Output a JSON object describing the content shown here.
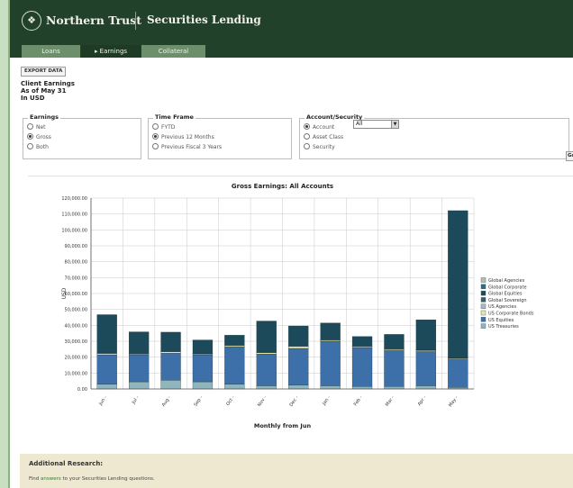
{
  "header": {
    "brand": "Northern Trust",
    "app_title": "Securities Lending"
  },
  "tabs": [
    {
      "label": "Loans",
      "active": false
    },
    {
      "label": "▸ Earnings",
      "active": true
    },
    {
      "label": "Collateral",
      "active": false
    }
  ],
  "export_label": "EXPORT DATA",
  "info": {
    "line1": "Client Earnings",
    "line2": "As of May 31",
    "line3": "In USD"
  },
  "earnings_box": {
    "legend": "Earnings",
    "options": [
      {
        "label": "Net",
        "selected": false
      },
      {
        "label": "Gross",
        "selected": true
      },
      {
        "label": "Both",
        "selected": false
      }
    ]
  },
  "timeframe_box": {
    "legend": "Time Frame",
    "options": [
      {
        "label": "FYTD",
        "selected": false
      },
      {
        "label": "Previous 12 Months",
        "selected": true
      },
      {
        "label": "Previous Fiscal 3 Years",
        "selected": false
      }
    ]
  },
  "account_box": {
    "legend": "Account/Security",
    "options": [
      {
        "label": "Account",
        "selected": true
      },
      {
        "label": "Asset Class",
        "selected": false
      },
      {
        "label": "Security",
        "selected": false
      }
    ],
    "select_value": "All"
  },
  "go_label": "Go",
  "chart_data": {
    "type": "bar",
    "stacked": true,
    "title": "Gross Earnings: All Accounts",
    "xlabel": "Monthly from Jun",
    "ylabel": "USD",
    "ylim": [
      0,
      120000
    ],
    "yticks": [
      0,
      10000,
      20000,
      30000,
      40000,
      50000,
      60000,
      70000,
      80000,
      90000,
      100000,
      110000,
      120000
    ],
    "ytick_labels": [
      "0.00",
      "10,000.00",
      "20,000.00",
      "30,000.00",
      "40,000.00",
      "50,000.00",
      "60,000.00",
      "70,000.00",
      "80,000.00",
      "90,000.00",
      "100,000.00",
      "110,000.00",
      "120,000.00"
    ],
    "categories": [
      "Jun -",
      "Jul -",
      "Aug -",
      "Sep -",
      "Oct -",
      "Nov -",
      "Dec -",
      "Jan -",
      "Feb -",
      "Mar -",
      "Apr -",
      "May -"
    ],
    "grid": true,
    "legend_position": "right",
    "series": [
      {
        "name": "US Treasuries",
        "color": "#8fb5bd",
        "values": [
          3000,
          4500,
          5500,
          4500,
          3000,
          2000,
          2500,
          2000,
          1500,
          1500,
          2000,
          1000
        ]
      },
      {
        "name": "US Equities",
        "color": "#3d6fa8",
        "values": [
          18500,
          17000,
          17000,
          17000,
          23500,
          20000,
          23000,
          28000,
          24500,
          23000,
          21500,
          17500
        ]
      },
      {
        "name": "US Corporate Bonds",
        "color": "#e6e8a8",
        "values": [
          800,
          500,
          800,
          500,
          700,
          800,
          1200,
          600,
          600,
          600,
          600,
          500
        ]
      },
      {
        "name": "US Agencies",
        "color": "#a6bcc4",
        "values": [
          300,
          300,
          300,
          200,
          300,
          300,
          300,
          300,
          300,
          300,
          300,
          300
        ]
      },
      {
        "name": "Global Sovereign",
        "color": "#3a5f6b",
        "values": [
          100,
          100,
          100,
          100,
          100,
          100,
          100,
          100,
          100,
          100,
          100,
          100
        ]
      },
      {
        "name": "Global Equities",
        "color": "#1d4a5a",
        "values": [
          24000,
          13500,
          12000,
          8500,
          6200,
          19500,
          12500,
          10500,
          6000,
          8800,
          19000,
          92700
        ]
      },
      {
        "name": "Global Corporate",
        "color": "#2f6d84",
        "values": [
          0,
          0,
          0,
          0,
          0,
          0,
          0,
          0,
          0,
          0,
          0,
          0
        ]
      },
      {
        "name": "Global Agencies",
        "color": "#b4bcbc",
        "values": [
          0,
          0,
          0,
          0,
          0,
          0,
          0,
          0,
          0,
          0,
          0,
          0
        ]
      }
    ],
    "legend_order": [
      "Global Agencies",
      "Global Corporate",
      "Global Equities",
      "Global Sovereign",
      "US Agencies",
      "US Corporate Bonds",
      "US Equities",
      "US Treasuries"
    ]
  },
  "research": {
    "title": "Additional Research:",
    "text_before": "Find ",
    "link": "answers",
    "text_after": " to your Securities Lending questions."
  }
}
